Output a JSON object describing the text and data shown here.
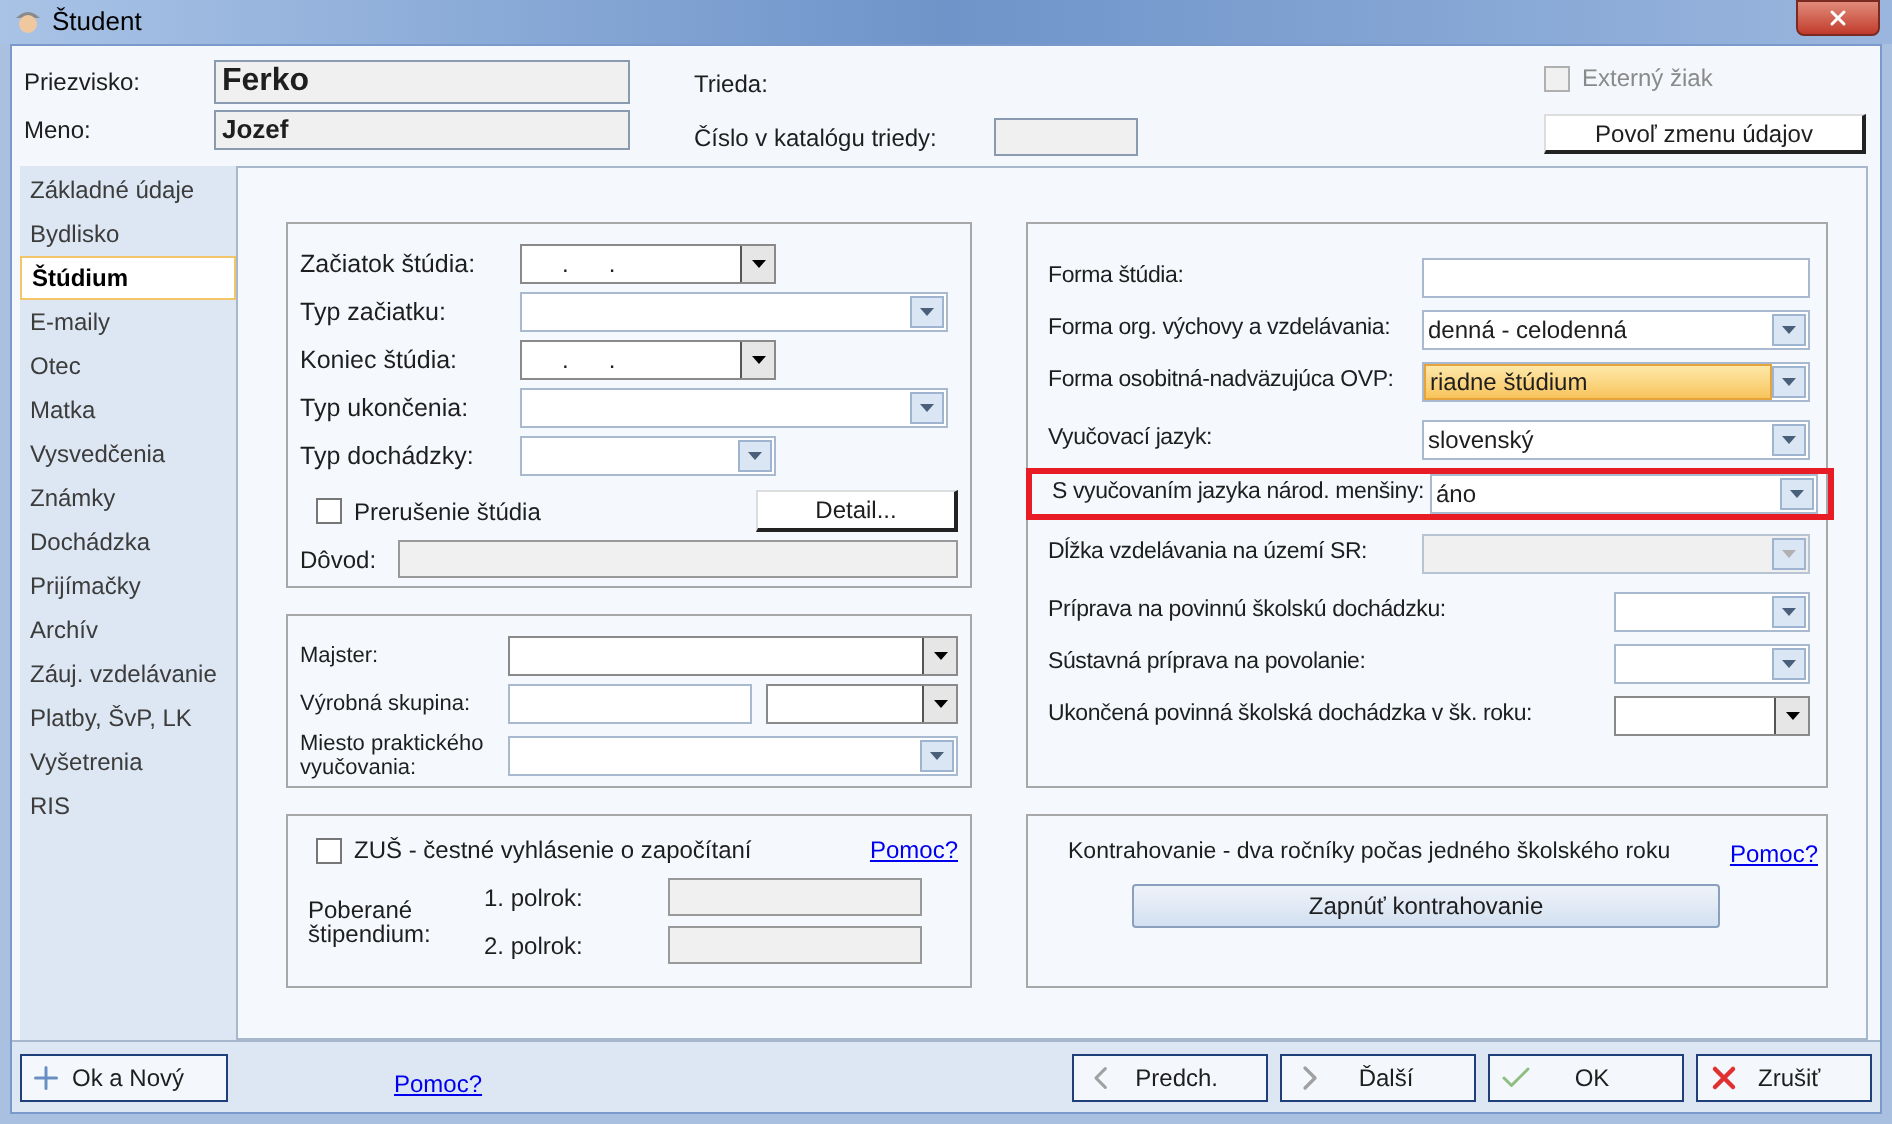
{
  "window": {
    "title": "Študent"
  },
  "header": {
    "surname": {
      "label": "Priezvisko:",
      "value": "Ferko"
    },
    "name": {
      "label": "Meno:",
      "value": "Jozef"
    },
    "class_label": "Trieda:",
    "catalog_label": "Číslo v katalógu triedy:",
    "external": {
      "label": "Externý žiak",
      "checked": false,
      "disabled": true
    },
    "edit_button": "Povoľ zmenu údajov"
  },
  "sidebar": {
    "items": [
      {
        "label": "Základné údaje",
        "selected": false
      },
      {
        "label": "Bydlisko",
        "selected": false
      },
      {
        "label": "Štúdium",
        "selected": true
      },
      {
        "label": "E-maily",
        "selected": false
      },
      {
        "label": "Otec",
        "selected": false
      },
      {
        "label": "Matka",
        "selected": false
      },
      {
        "label": "Vysvedčenia",
        "selected": false
      },
      {
        "label": "Známky",
        "selected": false
      },
      {
        "label": "Dochádzka",
        "selected": false
      },
      {
        "label": "Prijímačky",
        "selected": false
      },
      {
        "label": "Archív",
        "selected": false
      },
      {
        "label": "Záuj. vzdelávanie",
        "selected": false
      },
      {
        "label": "Platby, ŠvP, LK",
        "selected": false
      },
      {
        "label": "Vyšetrenia",
        "selected": false
      },
      {
        "label": "RIS",
        "selected": false
      }
    ]
  },
  "study": {
    "rows": [
      {
        "label": "Začiatok štúdia:",
        "kind": "date",
        "wide": false,
        "value": ".      ."
      },
      {
        "label": "Typ začiatku:",
        "kind": "combo",
        "wide": true
      },
      {
        "label": "Koniec štúdia:",
        "kind": "date",
        "wide": false,
        "value": ".      ."
      },
      {
        "label": "Typ ukončenia:",
        "kind": "combo",
        "wide": true
      },
      {
        "label": "Typ dochádzky:",
        "kind": "combo",
        "wide": false
      }
    ],
    "interruption": {
      "label": "Prerušenie štúdia",
      "checked": false
    },
    "detail_button": "Detail...",
    "reason_label": "Dôvod:"
  },
  "practice": {
    "rows": [
      {
        "label": "Majster:",
        "kind": "dropdown"
      },
      {
        "label": "Výrobná skupina:",
        "kind": "split"
      },
      {
        "label": "Miesto praktického vyučovania:",
        "kind": "combo"
      }
    ]
  },
  "art_school": {
    "checkbox": {
      "label": "ZUŠ - čestné vyhlásenie o započítaní",
      "checked": false
    },
    "help_link": "Pomoc?",
    "stipend_label": "Poberané štipendium:",
    "semesters": [
      {
        "label": "1. polrok:"
      },
      {
        "label": "2. polrok:"
      }
    ]
  },
  "education": {
    "rows": [
      {
        "label": "Forma štúdia:",
        "kind": "text",
        "wide": true,
        "disabled": false,
        "focused": false,
        "marked": false
      },
      {
        "label": "Forma org. výchovy a vzdelávania:",
        "kind": "combo",
        "wide": true,
        "value": "denná - celodenná",
        "disabled": false,
        "focused": false,
        "marked": false
      },
      {
        "label": "Forma osobitná-nadväzujúca OVP:",
        "kind": "combo",
        "wide": true,
        "value": "riadne štúdium",
        "disabled": false,
        "focused": true,
        "marked": false
      },
      {
        "label": "Vyučovací jazyk:",
        "kind": "combo",
        "wide": true,
        "value": "slovenský",
        "disabled": false,
        "focused": false,
        "marked": false
      },
      {
        "label": "S vyučovaním jazyka národ. menšiny:",
        "kind": "combo",
        "wide": true,
        "value": "áno",
        "disabled": false,
        "focused": false,
        "marked": true
      },
      {
        "label": "Dĺžka vzdelávania na území SR:",
        "kind": "combo",
        "wide": true,
        "disabled": true,
        "focused": false,
        "marked": false
      },
      {
        "label": "Príprava na povinnú školskú dochádzku:",
        "kind": "combo",
        "wide": false,
        "disabled": false,
        "focused": false,
        "marked": false
      },
      {
        "label": "Sústavná príprava na povolanie:",
        "kind": "combo",
        "wide": false,
        "disabled": false,
        "focused": false,
        "marked": false
      },
      {
        "label": "Ukončená povinná školská dochádzka v šk. roku:",
        "kind": "dropdown",
        "wide": false,
        "disabled": false,
        "focused": false,
        "marked": false
      }
    ]
  },
  "acceleration": {
    "text": "Kontrahovanie - dva ročníky počas jedného školského roku",
    "help_link": "Pomoc?",
    "button": "Zapnúť kontrahovanie"
  },
  "footer": {
    "left_button": {
      "label": "Ok a Nový",
      "kind": "add"
    },
    "help_link": "Pomoc?",
    "buttons": [
      {
        "label": "Predch.",
        "kind": "prev"
      },
      {
        "label": "Ďalší",
        "kind": "next"
      },
      {
        "label": "OK",
        "kind": "ok"
      },
      {
        "label": "Zrušiť",
        "kind": "cancel"
      }
    ]
  }
}
